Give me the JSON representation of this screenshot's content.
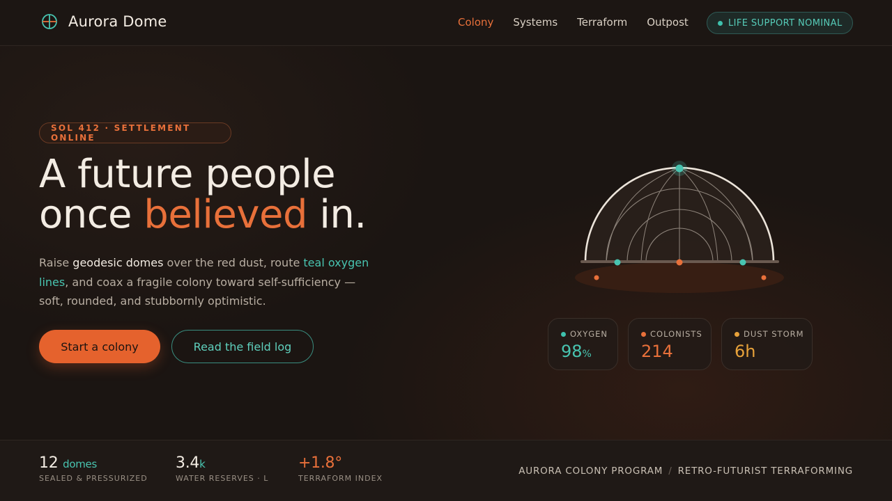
{
  "brand": {
    "name": "Aurora Dome",
    "icon": "globe-icon"
  },
  "nav": {
    "items": [
      {
        "label": "Colony",
        "active": true
      },
      {
        "label": "Systems",
        "active": false
      },
      {
        "label": "Terraform",
        "active": false
      },
      {
        "label": "Outpost",
        "active": false
      }
    ],
    "status": "LIFE SUPPORT NOMINAL"
  },
  "hero": {
    "tag": "SOL 412 · SETTLEMENT ONLINE",
    "headline_line1": "A future people",
    "headline_line2_pre": "once ",
    "headline_accent": "believed",
    "headline_line2_post": " in.",
    "lede_1": "Raise ",
    "lede_strong": "geodesic domes",
    "lede_2": " over the red dust, route ",
    "lede_teal": "teal oxygen lines",
    "lede_3": ", and coax a fragile colony toward self-sufficiency — soft, rounded, and stubbornly optimistic.",
    "primary_cta": "Start a colony",
    "secondary_cta": "Read the field log"
  },
  "stats": [
    {
      "label": "OXYGEN",
      "value": "98",
      "unit": "%",
      "color": "#48c4b0"
    },
    {
      "label": "COLONISTS",
      "value": "214",
      "unit": "",
      "color": "#e8703a"
    },
    {
      "label": "DUST STORM",
      "value": "6h",
      "unit": "",
      "color": "#e8a23a"
    }
  ],
  "footer": {
    "stats": [
      {
        "value": "12",
        "unit": "domes",
        "label": "SEALED & PRESSURIZED"
      },
      {
        "value": "3.4",
        "unit": "k",
        "label": "WATER RESERVES · L"
      },
      {
        "value": "+1.8°",
        "unit": "",
        "label": "TERRAFORM INDEX"
      }
    ],
    "program": "AURORA COLONY PROGRAM",
    "separator": "/",
    "tagline": "RETRO-FUTURIST TERRAFORMING"
  },
  "colors": {
    "accent_orange": "#e8703a",
    "accent_teal": "#48c4b0",
    "accent_amber": "#e8a23a",
    "background": "#1b1512"
  }
}
